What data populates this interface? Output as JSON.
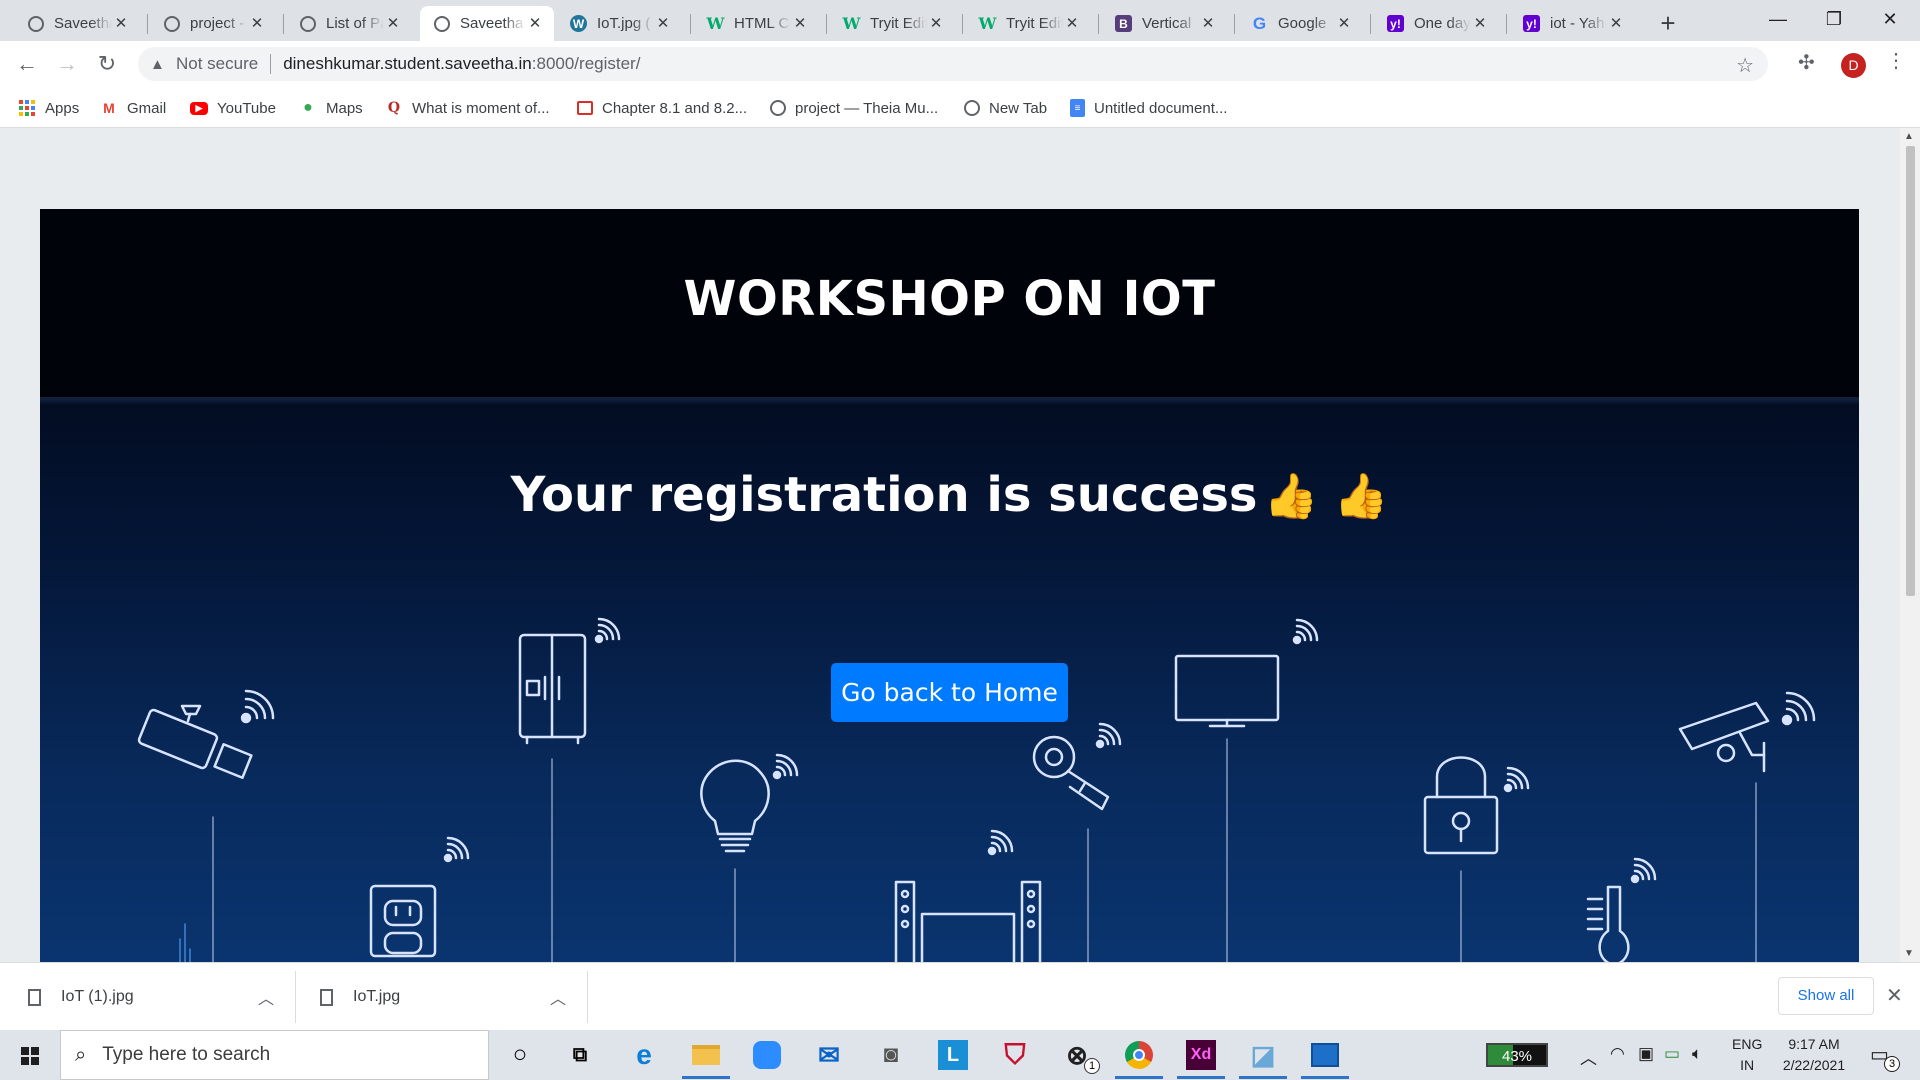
{
  "browser": {
    "tabs": [
      {
        "title": "Saveetha",
        "icon": "globe-icon"
      },
      {
        "title": "project -",
        "icon": "globe-icon"
      },
      {
        "title": "List of Pa",
        "icon": "globe-icon"
      },
      {
        "title": "Saveetha",
        "icon": "globe-icon",
        "active": true
      },
      {
        "title": "IoT.jpg (",
        "icon": "wordpress-icon"
      },
      {
        "title": "HTML Ch",
        "icon": "w3schools-icon"
      },
      {
        "title": "Tryit Edit",
        "icon": "w3schools-icon"
      },
      {
        "title": "Tryit Edit",
        "icon": "w3schools-icon"
      },
      {
        "title": "Vertical",
        "icon": "bootstrap-icon"
      },
      {
        "title": "Google",
        "icon": "google-icon"
      },
      {
        "title": "One day",
        "icon": "yahoo-icon"
      },
      {
        "title": "iot - Yah",
        "icon": "yahoo-icon"
      }
    ],
    "address": {
      "security_label": "Not secure",
      "host": "dineshkumar.student.saveetha.in",
      "path": ":8000/register/"
    },
    "profile_initial": "D",
    "bookmarks": [
      {
        "label": "Apps",
        "icon": "apps-grid-icon"
      },
      {
        "label": "Gmail",
        "icon": "gmail-icon"
      },
      {
        "label": "YouTube",
        "icon": "youtube-icon"
      },
      {
        "label": "Maps",
        "icon": "maps-pin-icon"
      },
      {
        "label": "What is moment of...",
        "icon": "quora-icon"
      },
      {
        "label": "Chapter 8.1 and 8.2...",
        "icon": "slides-icon"
      },
      {
        "label": "project — Theia Mu...",
        "icon": "globe-icon"
      },
      {
        "label": "New Tab",
        "icon": "globe-icon"
      },
      {
        "label": "Untitled document...",
        "icon": "docs-icon"
      }
    ]
  },
  "page": {
    "title": "WORKSHOP ON IOT",
    "message": "Your registration is success",
    "thumbs": "👍 👍",
    "home_button": "Go back to Home"
  },
  "downloads": {
    "items": [
      {
        "name": "IoT (1).jpg"
      },
      {
        "name": "IoT.jpg"
      }
    ],
    "show_all": "Show all"
  },
  "taskbar": {
    "search_placeholder": "Type here to search",
    "battery_label": "43%",
    "battery_level": 0.43,
    "language": [
      "ENG",
      "IN"
    ],
    "time": "9:17 AM",
    "date": "2/22/2021",
    "notification_count": "3",
    "xbox_badge": "1"
  },
  "colors": {
    "accent_button": "#007bff",
    "hero_top": "#000208",
    "hero_bottom": "#0a3570",
    "icon_line": "#d8e4ff"
  }
}
